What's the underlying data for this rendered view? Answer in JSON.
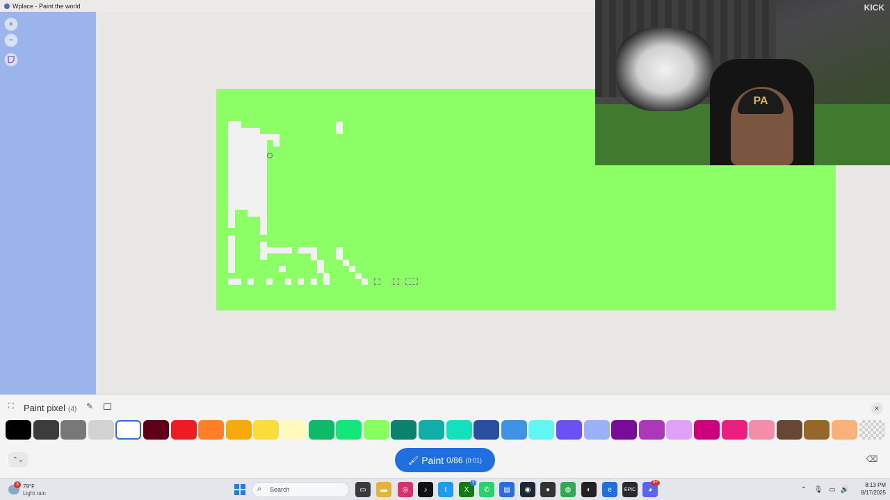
{
  "window": {
    "title": "Wplace - Paint the world"
  },
  "map_controls": {
    "zoom_in": "+",
    "zoom_out": "−"
  },
  "webcam": {
    "platform": "KICK",
    "cap_logo": "PA"
  },
  "toolbar": {
    "title": "Paint pixel",
    "count": "(4)",
    "paint_button": {
      "label": "Paint",
      "count": "0/86",
      "timer": "(0:01)"
    }
  },
  "palette": {
    "selected_index": 4,
    "colors": [
      "#000000",
      "#3c3c3c",
      "#787878",
      "#d2d2d2",
      "#ffffff",
      "#600018",
      "#ed1c24",
      "#ff7f27",
      "#f6aa09",
      "#f9dd3b",
      "#fffabc",
      "#0eb968",
      "#13e67b",
      "#87ff5e",
      "#0c816e",
      "#10aea6",
      "#13e1be",
      "#28509e",
      "#4093e4",
      "#60f7f2",
      "#6b50f6",
      "#99b1fb",
      "#780c99",
      "#aa38b9",
      "#e09ff9",
      "#cb007a",
      "#ec1f80",
      "#f38da9",
      "#684634",
      "#95682a",
      "#f8b277",
      "transparent"
    ]
  },
  "taskbar": {
    "weather": {
      "badge": "3",
      "temp": "79°F",
      "condition": "Light rain"
    },
    "search_placeholder": "Search",
    "notification_badge": "3",
    "discord_badge": "9+",
    "clock_time": "8:13 PM",
    "clock_date": "8/17/2025"
  }
}
